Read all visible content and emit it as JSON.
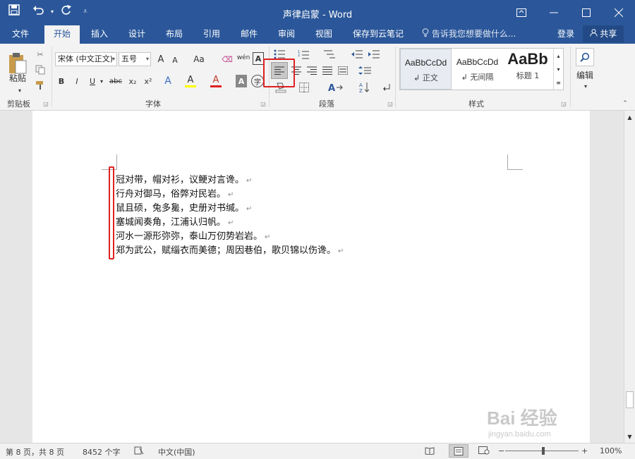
{
  "window": {
    "title": "声律启蒙 - Word",
    "qat_icons": [
      "save-icon",
      "undo-icon",
      "redo-icon",
      "customize-icon"
    ],
    "controls": [
      "ribbon-display-icon",
      "minimize-icon",
      "maximize-icon",
      "close-icon"
    ]
  },
  "tabs": [
    "文件",
    "开始",
    "插入",
    "设计",
    "布局",
    "引用",
    "邮件",
    "审阅",
    "视图",
    "保存到云笔记"
  ],
  "active_tab": "开始",
  "tell_me": "告诉我您想要做什么...",
  "login": "登录",
  "share": "共享",
  "clipboard": {
    "paste": "粘贴",
    "label": "剪贴板"
  },
  "font": {
    "name": "宋体 (中文正文)",
    "size": "五号",
    "label": "字体",
    "buttons": [
      "B",
      "I",
      "U",
      "abc",
      "x₂",
      "x²",
      "A",
      "A",
      "A",
      "A",
      "字"
    ],
    "grow": "A",
    "shrink": "A",
    "case": "Aa",
    "phonetic": "wén",
    "border_char": "A"
  },
  "paragraph": {
    "label": "段落"
  },
  "styles": {
    "label": "样式",
    "items": [
      {
        "sample": "AaBbCcDd",
        "name": "↲ 正文"
      },
      {
        "sample": "AaBbCcDd",
        "name": "↲ 无间隔"
      },
      {
        "sample": "AaBb",
        "name": "标题 1"
      }
    ]
  },
  "editing": {
    "label": "编辑"
  },
  "document": {
    "lines": [
      "冠对带，帽对衫，议鲠对言谗。",
      "行舟对御马，俗弊对民岩。",
      "鼠且硕，兔多毚，史册对书缄。",
      "塞城闻奏角，江浦认归帆。",
      "河水一源形弥弥，泰山万仞势岩岩。",
      "郑为武公，赋缁衣而美德；周因巷伯，歌贝锦以伤谗。"
    ],
    "para_mark": "↵"
  },
  "status": {
    "page": "第 8 页，共 8 页",
    "words": "8452 个字",
    "lang": "中文(中国)",
    "zoom": "100%"
  },
  "watermark": {
    "brand": "Bai 经验",
    "url": "jingyan.baidu.com"
  },
  "accent": "#2b579a",
  "highlight_color": "#e02020"
}
